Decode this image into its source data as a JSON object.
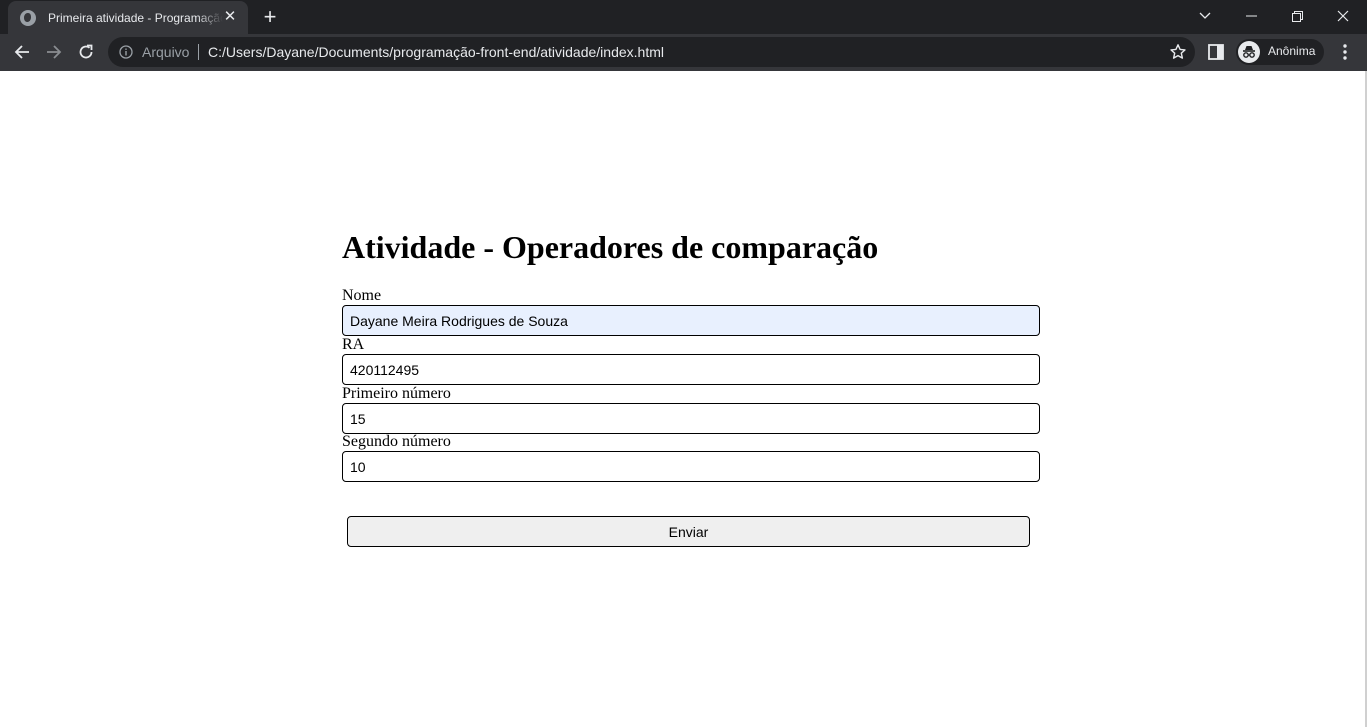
{
  "browser": {
    "tab_title": "Primeira atividade - Programação",
    "scheme_label": "Arquivo",
    "url": "C:/Users/Dayane/Documents/programação-front-end/atividade/index.html",
    "profile_label": "Anônima"
  },
  "page": {
    "heading": "Atividade - Operadores de comparação",
    "fields": [
      {
        "label": "Nome",
        "value": "Dayane Meira Rodrigues de Souza"
      },
      {
        "label": "RA",
        "value": "420112495"
      },
      {
        "label": "Primeiro número",
        "value": "15"
      },
      {
        "label": "Segundo número",
        "value": "10"
      }
    ],
    "submit_label": "Enviar"
  }
}
